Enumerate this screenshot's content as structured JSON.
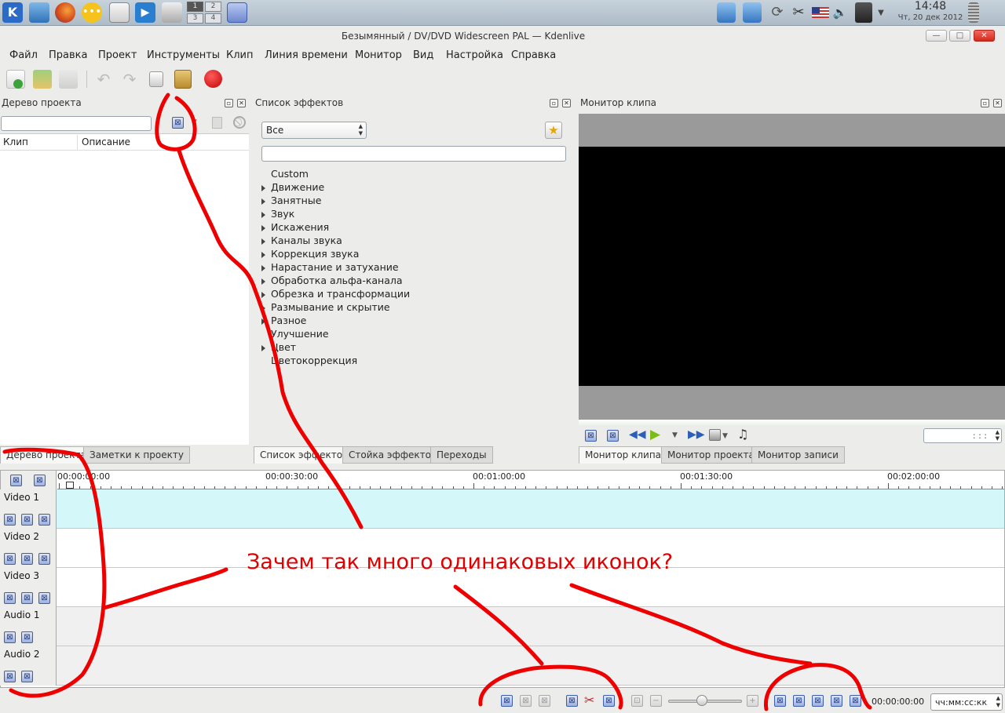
{
  "taskbar": {
    "clock_time": "14:48",
    "clock_date": "Чт, 20 дек 2012",
    "pager": [
      "1",
      "2",
      "3",
      "4"
    ]
  },
  "window": {
    "title": "Безымянный / DV/DVD Widescreen PAL — Kdenlive"
  },
  "menu": [
    "Файл",
    "Правка",
    "Проект",
    "Инструменты",
    "Клип",
    "Линия времени",
    "Монитор",
    "Вид",
    "Настройка",
    "Справка"
  ],
  "project_tree": {
    "title": "Дерево проекта",
    "col_clip": "Клип",
    "col_description": "Описание",
    "tabs": [
      "Дерево проекта",
      "Заметки к проекту"
    ]
  },
  "effects": {
    "title": "Список эффектов",
    "filter_value": "Все",
    "items": [
      {
        "label": "Custom",
        "expandable": false
      },
      {
        "label": "Движение",
        "expandable": true
      },
      {
        "label": "Занятные",
        "expandable": true
      },
      {
        "label": "Звук",
        "expandable": true
      },
      {
        "label": "Искажения",
        "expandable": true
      },
      {
        "label": "Каналы звука",
        "expandable": true
      },
      {
        "label": "Коррекция звука",
        "expandable": true
      },
      {
        "label": "Нарастание и затухание",
        "expandable": true
      },
      {
        "label": "Обработка альфа-канала",
        "expandable": true
      },
      {
        "label": "Обрезка и трансформации",
        "expandable": true
      },
      {
        "label": "Размывание и скрытие",
        "expandable": true
      },
      {
        "label": "Разное",
        "expandable": true
      },
      {
        "label": "Улучшение",
        "expandable": false
      },
      {
        "label": "Цвет",
        "expandable": true
      },
      {
        "label": "Цветокоррекция",
        "expandable": false
      }
    ],
    "tabs": [
      "Список эффектов",
      "Стойка эффектов",
      "Переходы"
    ]
  },
  "monitor": {
    "title": "Монитор клипа",
    "timecode": ": : :",
    "tabs": [
      "Монитор клипа",
      "Монитор проекта",
      "Монитор записи"
    ]
  },
  "timeline": {
    "ruler_labels": [
      "00:00:00:00",
      "00:00:30:00",
      "00:01:00:00",
      "00:01:30:00",
      "00:02:00:00"
    ],
    "tracks": [
      {
        "name": "Video 1",
        "icons": 3
      },
      {
        "name": "Video 2",
        "icons": 3
      },
      {
        "name": "Video 3",
        "icons": 3
      },
      {
        "name": "Audio 1",
        "icons": 2
      },
      {
        "name": "Audio 2",
        "icons": 2
      }
    ],
    "position": "00:00:00:00",
    "time_format": "чч:мм:сс:кк"
  },
  "annotation": {
    "text": "Зачем так много одинаковых иконок?",
    "color": "#e00000"
  },
  "colors": {
    "selected_track": "#d4f7fa",
    "monitor_bg": "#9a9a9a",
    "record_button": "#d40000"
  }
}
